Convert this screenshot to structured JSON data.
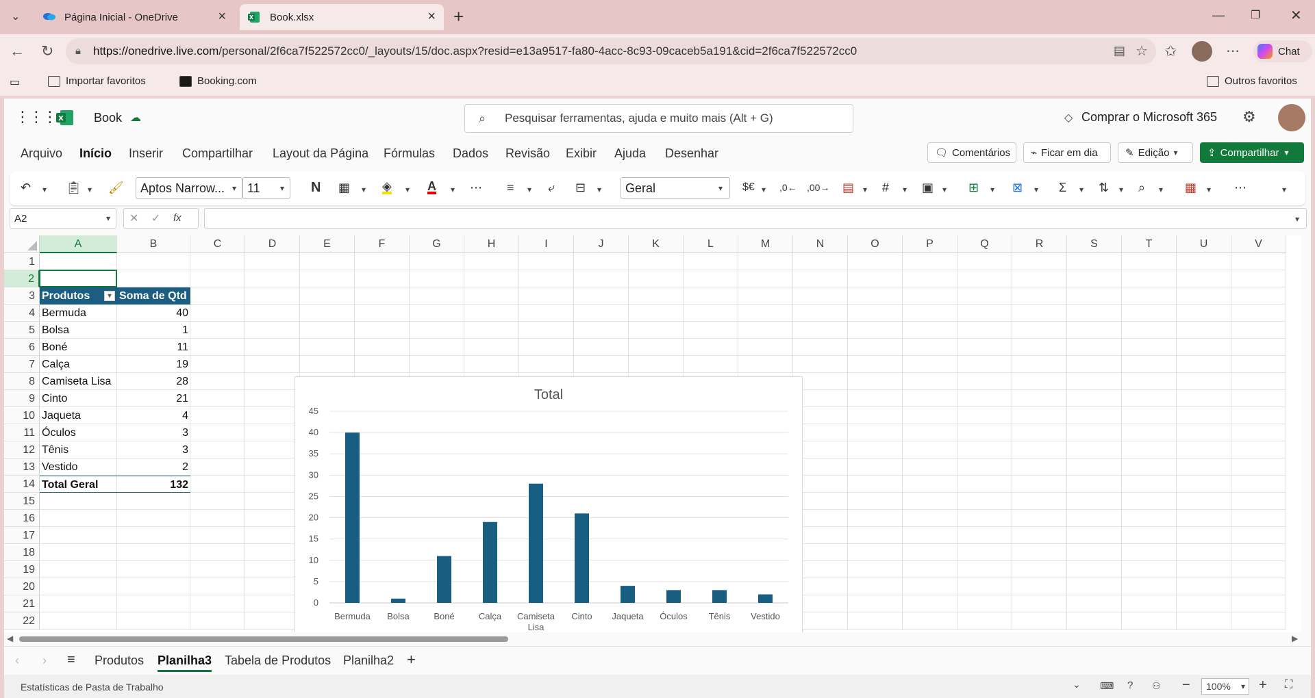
{
  "browser": {
    "tabs": [
      {
        "title": "Página Inicial - OneDrive",
        "active": false
      },
      {
        "title": "Book.xlsx",
        "active": true
      }
    ],
    "url_host": "https://onedrive.live.com",
    "url_path": "/personal/2f6ca7f522572cc0/_layouts/15/doc.aspx?resid=e13a9517-fa80-4acc-8c93-09caceb5a191&cid=2f6ca7f522572cc0",
    "chat_label": "Chat",
    "favorites": [
      "Importar favoritos",
      "Booking.com"
    ],
    "other_favorites": "Outros favoritos"
  },
  "app": {
    "doc_name": "Book",
    "search_placeholder": "Pesquisar ferramentas, ajuda e muito mais (Alt + G)",
    "buy_label": "Comprar o Microsoft 365",
    "menu": [
      "Arquivo",
      "Início",
      "Inserir",
      "Compartilhar",
      "Layout da Página",
      "Fórmulas",
      "Dados",
      "Revisão",
      "Exibir",
      "Ajuda",
      "Desenhar"
    ],
    "active_menu": "Início",
    "comments_label": "Comentários",
    "catchup_label": "Ficar em dia",
    "editing_label": "Edição",
    "share_label": "Compartilhar",
    "accent": "#117a3b"
  },
  "ribbon": {
    "font_name": "Aptos Narrow...",
    "font_size": "11",
    "bold_glyph": "N",
    "number_format": "Geral",
    "currency_glyph": "$€"
  },
  "formula": {
    "name_box": "A2",
    "fx_label": "fx",
    "content": ""
  },
  "grid": {
    "columns": [
      "A",
      "B",
      "C",
      "D",
      "E",
      "F",
      "G",
      "H",
      "I",
      "J",
      "K",
      "L",
      "M",
      "N",
      "O",
      "P",
      "Q",
      "R",
      "S",
      "T",
      "U",
      "V"
    ],
    "rows": [
      "1",
      "2",
      "3",
      "4",
      "5",
      "6",
      "7",
      "8",
      "9",
      "10",
      "11",
      "12",
      "13",
      "14",
      "15",
      "16",
      "17",
      "18",
      "19",
      "20",
      "21",
      "22"
    ],
    "selected_cell": "A2",
    "header_color": "#1b5e82",
    "pivot": {
      "headers": [
        "Produtos",
        "Soma de Qtd"
      ],
      "rows": [
        [
          "Bermuda",
          "40"
        ],
        [
          "Bolsa",
          "1"
        ],
        [
          "Boné",
          "11"
        ],
        [
          "Calça",
          "19"
        ],
        [
          "Camiseta Lisa",
          "28"
        ],
        [
          "Cinto",
          "21"
        ],
        [
          "Jaqueta",
          "4"
        ],
        [
          "Óculos",
          "3"
        ],
        [
          "Tênis",
          "3"
        ],
        [
          "Vestido",
          "2"
        ]
      ],
      "total": [
        "Total Geral",
        "132"
      ]
    }
  },
  "chart_data": {
    "type": "bar",
    "title": "Total",
    "categories": [
      "Bermuda",
      "Bolsa",
      "Boné",
      "Calça",
      "Camiseta Lisa",
      "Cinto",
      "Jaqueta",
      "Óculos",
      "Tênis",
      "Vestido"
    ],
    "series": [
      {
        "name": "Total",
        "values": [
          40,
          1,
          11,
          19,
          28,
          21,
          4,
          3,
          3,
          2
        ]
      }
    ],
    "ylim": [
      0,
      45
    ],
    "yticks": [
      0,
      5,
      10,
      15,
      20,
      25,
      30,
      35,
      40,
      45
    ],
    "grid": true,
    "legend": "bottom",
    "bar_color": "#185e82"
  },
  "sheets": {
    "tabs": [
      "Produtos",
      "Planilha3",
      "Tabela de Produtos",
      "Planilha2"
    ],
    "active": "Planilha3"
  },
  "status": {
    "left": "Estatísticas de Pasta de Trabalho",
    "zoom": "100%"
  }
}
